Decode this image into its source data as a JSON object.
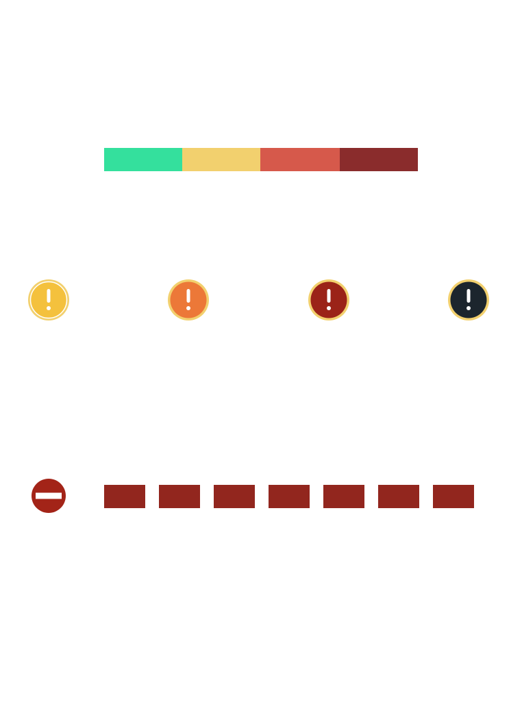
{
  "severity_scale": {
    "segments": [
      {
        "level": "1",
        "color": "#34e09d"
      },
      {
        "level": "2",
        "color": "#f2d06e"
      },
      {
        "level": "3",
        "color": "#d6594b"
      },
      {
        "level": "4",
        "color": "#8a2c2c"
      }
    ]
  },
  "warning_icons": [
    {
      "icon": "exclamation-icon",
      "fill": "#f4c13d",
      "ring": "#f2d06e"
    },
    {
      "icon": "exclamation-icon",
      "fill": "#ec7838",
      "ring": "#f2d06e"
    },
    {
      "icon": "exclamation-icon",
      "fill": "#9b2318",
      "ring": "#f2d06e"
    },
    {
      "icon": "exclamation-icon",
      "fill": "#1c252d",
      "ring": "#f2d06e"
    }
  ],
  "blocked_row": {
    "icon": "no-entry-icon",
    "icon_color": "#a32418",
    "block_color": "#92261e",
    "block_count": 7
  }
}
